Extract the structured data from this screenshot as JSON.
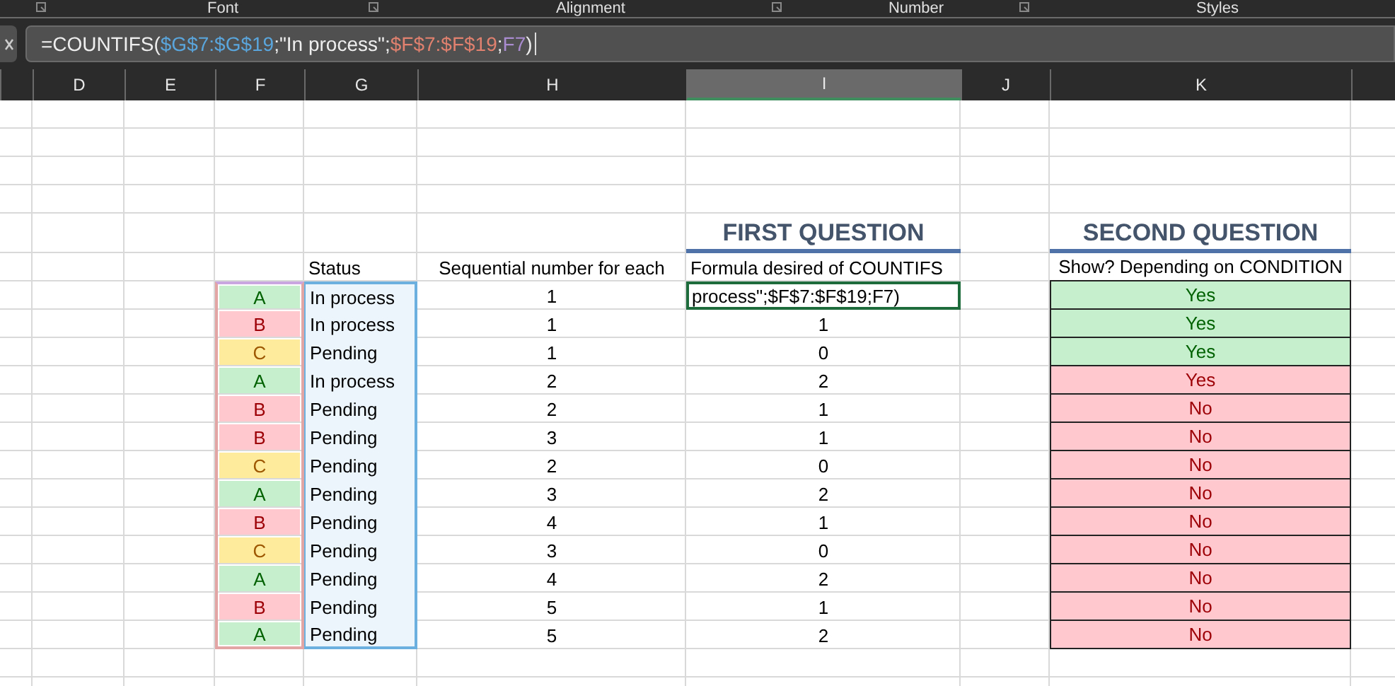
{
  "ribbon_groups": [
    {
      "launcher": true
    },
    {
      "label": "Font",
      "launcher": true
    },
    {
      "label": "Alignment",
      "launcher": true
    },
    {
      "label": "Number",
      "launcher": true
    },
    {
      "label": "Styles",
      "launcher": false
    }
  ],
  "formula_bar": {
    "segments": [
      {
        "kind": "text",
        "text": "=COUNTIFS("
      },
      {
        "kind": "ref",
        "text": "$G$7:$G$19",
        "color": "#5aa6dc"
      },
      {
        "kind": "text",
        "text": ";\"In process\";"
      },
      {
        "kind": "ref",
        "text": "$F$7:$F$19",
        "color": "#e0806e"
      },
      {
        "kind": "text",
        "text": ";"
      },
      {
        "kind": "ref",
        "text": "F7",
        "color": "#a98bd0"
      },
      {
        "kind": "text",
        "text": ")"
      }
    ]
  },
  "columns": [
    {
      "label": "D",
      "selected": false
    },
    {
      "label": "E",
      "selected": false
    },
    {
      "label": "F",
      "selected": false
    },
    {
      "label": "G",
      "selected": false
    },
    {
      "label": "H",
      "selected": false
    },
    {
      "label": "I",
      "selected": true
    },
    {
      "label": "J",
      "selected": false
    },
    {
      "label": "K",
      "selected": false
    }
  ],
  "titles": {
    "first": "FIRST QUESTION",
    "second": "SECOND QUESTION"
  },
  "headers": {
    "status": "Status",
    "seq": "Sequential number for each",
    "count": "Formula desired of COUNTIFS",
    "show": "Show? Depending on CONDITION"
  },
  "rows": [
    {
      "grade": {
        "text": "A",
        "color": "#c6efce"
      },
      "status": "In process",
      "seq": "1",
      "count": "process\";$F$7:$F$19;F7)",
      "editing": true,
      "show": {
        "text": "Yes",
        "color": "#c6efce"
      }
    },
    {
      "grade": {
        "text": "B",
        "color": "#ffc7ce"
      },
      "status": "In process",
      "seq": "1",
      "count": "1",
      "editing": false,
      "show": {
        "text": "Yes",
        "color": "#c6efce"
      }
    },
    {
      "grade": {
        "text": "C",
        "color": "#ffeb9c"
      },
      "status": "Pending",
      "seq": "1",
      "count": "0",
      "editing": false,
      "show": {
        "text": "Yes",
        "color": "#c6efce"
      }
    },
    {
      "grade": {
        "text": "A",
        "color": "#c6efce"
      },
      "status": "In process",
      "seq": "2",
      "count": "2",
      "editing": false,
      "show": {
        "text": "Yes",
        "color": "#ffc7ce"
      }
    },
    {
      "grade": {
        "text": "B",
        "color": "#ffc7ce"
      },
      "status": "Pending",
      "seq": "2",
      "count": "1",
      "editing": false,
      "show": {
        "text": "No",
        "color": "#ffc7ce"
      }
    },
    {
      "grade": {
        "text": "B",
        "color": "#ffc7ce"
      },
      "status": "Pending",
      "seq": "3",
      "count": "1",
      "editing": false,
      "show": {
        "text": "No",
        "color": "#ffc7ce"
      }
    },
    {
      "grade": {
        "text": "C",
        "color": "#ffeb9c"
      },
      "status": "Pending",
      "seq": "2",
      "count": "0",
      "editing": false,
      "show": {
        "text": "No",
        "color": "#ffc7ce"
      }
    },
    {
      "grade": {
        "text": "A",
        "color": "#c6efce"
      },
      "status": "Pending",
      "seq": "3",
      "count": "2",
      "editing": false,
      "show": {
        "text": "No",
        "color": "#ffc7ce"
      }
    },
    {
      "grade": {
        "text": "B",
        "color": "#ffc7ce"
      },
      "status": "Pending",
      "seq": "4",
      "count": "1",
      "editing": false,
      "show": {
        "text": "No",
        "color": "#ffc7ce"
      }
    },
    {
      "grade": {
        "text": "C",
        "color": "#ffeb9c"
      },
      "status": "Pending",
      "seq": "3",
      "count": "0",
      "editing": false,
      "show": {
        "text": "No",
        "color": "#ffc7ce"
      }
    },
    {
      "grade": {
        "text": "A",
        "color": "#c6efce"
      },
      "status": "Pending",
      "seq": "4",
      "count": "2",
      "editing": false,
      "show": {
        "text": "No",
        "color": "#ffc7ce"
      }
    },
    {
      "grade": {
        "text": "B",
        "color": "#ffc7ce"
      },
      "status": "Pending",
      "seq": "5",
      "count": "1",
      "editing": false,
      "show": {
        "text": "No",
        "color": "#ffc7ce"
      }
    },
    {
      "grade": {
        "text": "A",
        "color": "#c6efce"
      },
      "status": "Pending",
      "seq": "5",
      "count": "2",
      "editing": false,
      "show": {
        "text": "No",
        "color": "#ffc7ce"
      }
    }
  ]
}
